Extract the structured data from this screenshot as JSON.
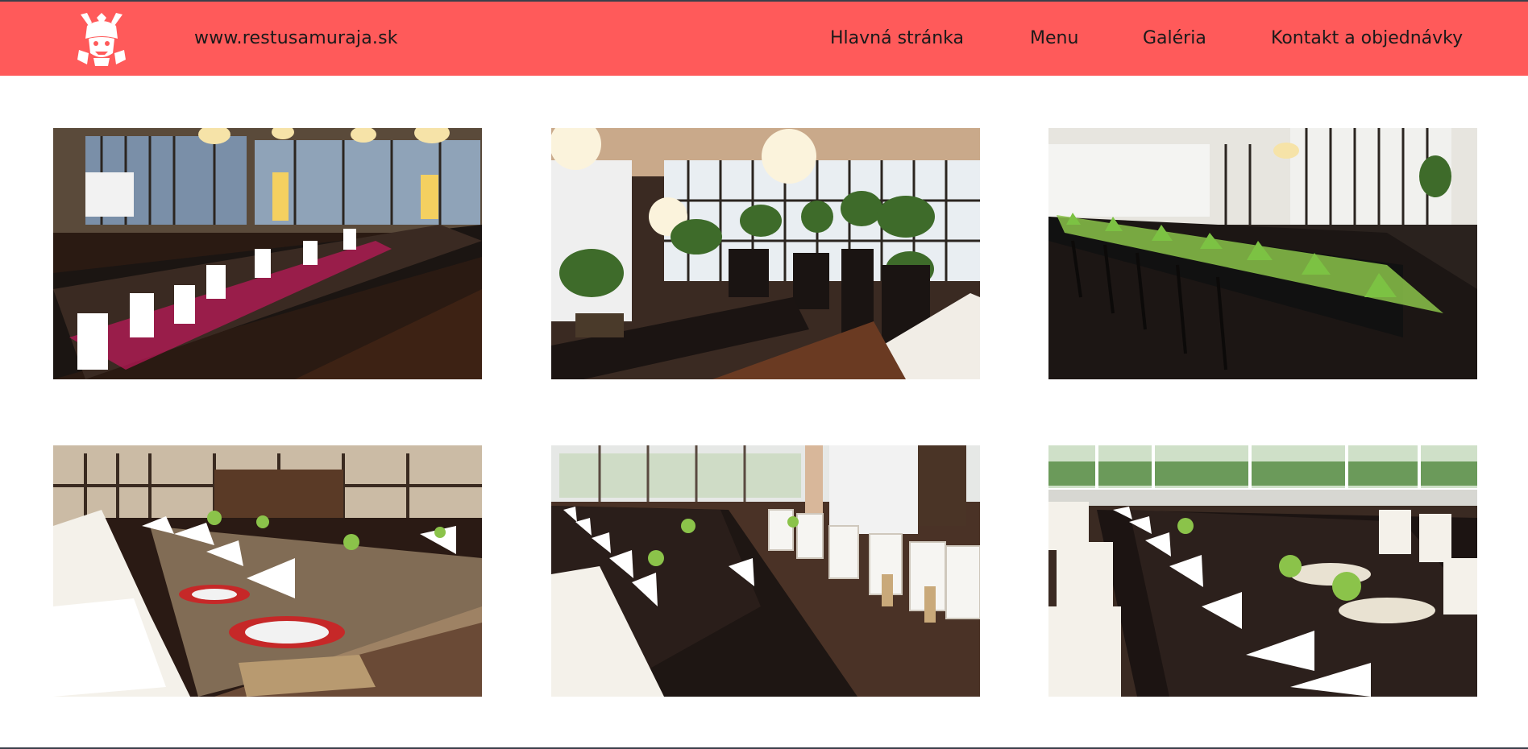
{
  "header": {
    "background_color": "#ff5a5a",
    "logo_icon": "samurai-helmet-icon",
    "site_url": "www.restusamuraja.sk"
  },
  "nav": {
    "items": [
      {
        "label": "Hlavná stránka"
      },
      {
        "label": "Menu"
      },
      {
        "label": "Galéria"
      },
      {
        "label": "Kontakt a objednávky"
      }
    ]
  },
  "gallery": {
    "photo_count": 6,
    "photos": [
      {
        "icon": "restaurant-photo-banquet-red"
      },
      {
        "icon": "restaurant-photo-bonsai-interior"
      },
      {
        "icon": "restaurant-photo-green-decor"
      },
      {
        "icon": "restaurant-photo-wedding-table"
      },
      {
        "icon": "restaurant-photo-white-chairs"
      },
      {
        "icon": "restaurant-photo-river-view"
      }
    ]
  }
}
